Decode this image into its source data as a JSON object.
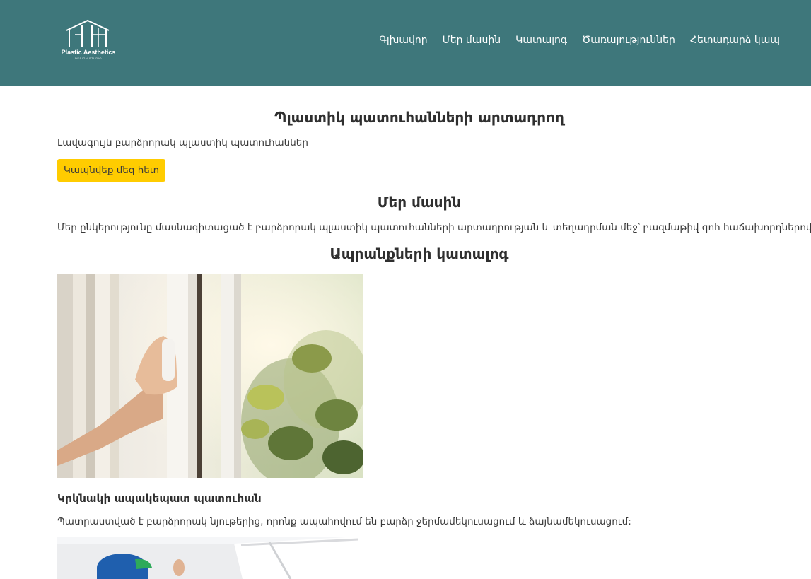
{
  "header": {
    "logo": {
      "name": "Plastic Aesthetics",
      "tagline": "DESIGN STUDIO"
    },
    "nav": [
      {
        "label": "Գլխավոր"
      },
      {
        "label": "Մեր մասին"
      },
      {
        "label": "Կատալոգ"
      },
      {
        "label": "Ծառայություններ"
      },
      {
        "label": "Հետադարձ կապ"
      }
    ]
  },
  "hero": {
    "title": "Պլաստիկ պատուհանների արտադրող",
    "subtitle": "Լավագույն բարձրորակ պլաստիկ պատուհաններ",
    "cta_label": "Կապնվեք մեզ հետ"
  },
  "about": {
    "title": "Մեր մասին",
    "text": "Մեր ընկերությունը մասնագիտացած է բարձրորակ պլաստիկ պատուհանների արտադրության և տեղադրման մեջ՝ բազմաթիվ գոհ հաճախորդներով:"
  },
  "catalog": {
    "title": "Ապրանքների կատալոգ",
    "items": [
      {
        "name": "Կրկնակի ապակեպատ պատուհան",
        "description": "Պատրաստված է բարձրորակ նյութերից, որոնք ապահովում են բարձր ջերմամեկուսացում և ձայնամեկուսացում:"
      }
    ]
  },
  "colors": {
    "header_bg": "#3e777b",
    "accent": "#ffcc00"
  }
}
